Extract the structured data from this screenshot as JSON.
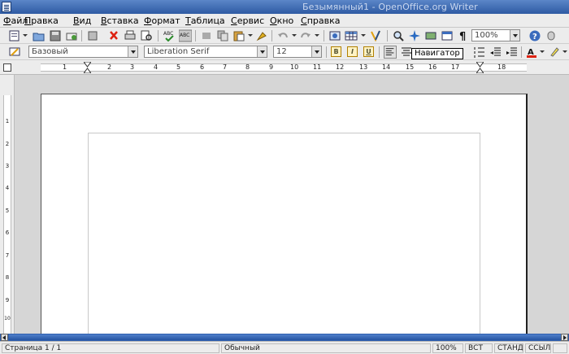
{
  "window": {
    "title": "Безымянный1 - OpenOffice.org Writer"
  },
  "menu": [
    "Файл",
    "Правка",
    "Вид",
    "Вставка",
    "Формат",
    "Таблица",
    "Сервис",
    "Окно",
    "Справка"
  ],
  "standard_toolbar": {
    "zoom": "100%"
  },
  "formatting_toolbar": {
    "style": "Базовый",
    "font": "Liberation Serif",
    "size": "12",
    "bold": "B",
    "italic": "I",
    "underline": "U"
  },
  "tooltip": "Навигатор",
  "ruler": {
    "h_marks": [
      "1",
      "2",
      "3",
      "4",
      "5",
      "6",
      "7",
      "8",
      "9",
      "10",
      "11",
      "12",
      "13",
      "14",
      "15",
      "16",
      "17",
      "18"
    ],
    "v_marks": [
      "1",
      "2",
      "3",
      "4",
      "5",
      "6",
      "7",
      "8",
      "9",
      "10"
    ]
  },
  "status": {
    "page": "Страница  1 / 1",
    "style": "Обычный",
    "zoom": "100%",
    "insert_mode": "ВСТ",
    "selection_mode": "СТАНД",
    "hyperlink_mode": "ССЫЛ"
  },
  "colors": {
    "titlebar": "#2e5aa3",
    "scrollbar": "#2f5fae",
    "chrome": "#ececec"
  }
}
